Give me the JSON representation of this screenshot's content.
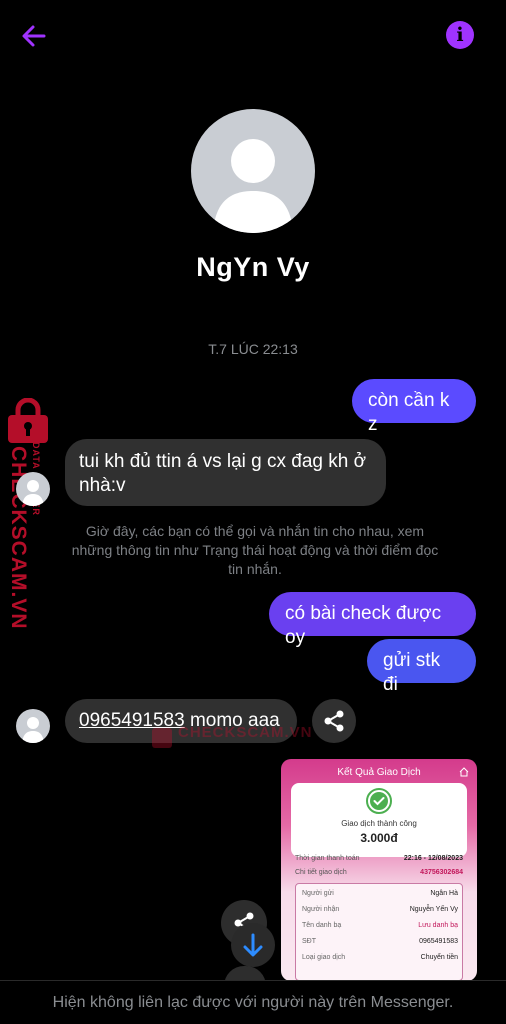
{
  "header": {
    "back_icon": "arrow-left-icon",
    "info_icon": "info-icon",
    "info_glyph": "i",
    "accent": "#a033ff"
  },
  "profile": {
    "name": "NgYn Vy",
    "avatar_icon": "default-user-avatar"
  },
  "conversation": {
    "timestamp": "T.7 LÚC 22:13",
    "messages": [
      {
        "from": "me",
        "text": "còn cần k z"
      },
      {
        "from": "them",
        "text": "tui kh đủ ttin á vs lại g cx đag kh ở nhà:v"
      },
      {
        "from": "me",
        "text": "có bài check được oy"
      },
      {
        "from": "me",
        "text": "gửi stk đi"
      },
      {
        "from": "them",
        "phone": "0965491583",
        "text_suffix": " momo aaa"
      }
    ],
    "system_note": "Giờ đây, các bạn có thể gọi và nhắn tin cho nhau, xem những thông tin như Trạng thái hoạt động và thời điểm đọc tin nhắn."
  },
  "watermark": {
    "brand": "CHECKSCAM.VN",
    "tagline": "DATA CENTER",
    "color": "#c8102e"
  },
  "receipt": {
    "title": "Kết Quả Giao Dịch",
    "status": "Giao dịch thành công",
    "amount": "3.000đ",
    "rows": [
      {
        "label": "Thời gian thanh toán",
        "value": "22:16 - 12/08/2023"
      },
      {
        "label": "Chi tiết giao dịch",
        "value": "43756302684"
      }
    ],
    "details": [
      {
        "label": "Người gửi",
        "value": "Ngân Hà"
      },
      {
        "label": "Người nhận",
        "value": "Nguyễn Yến Vy"
      },
      {
        "label": "Tên danh bạ",
        "value": "Lưu danh bạ"
      },
      {
        "label": "SĐT",
        "value": "0965491583"
      },
      {
        "label": "Loại giao dịch",
        "value": "Chuyển tiền"
      }
    ]
  },
  "footer": {
    "notice": "Hiện không liên lạc được với người này trên Messenger."
  }
}
